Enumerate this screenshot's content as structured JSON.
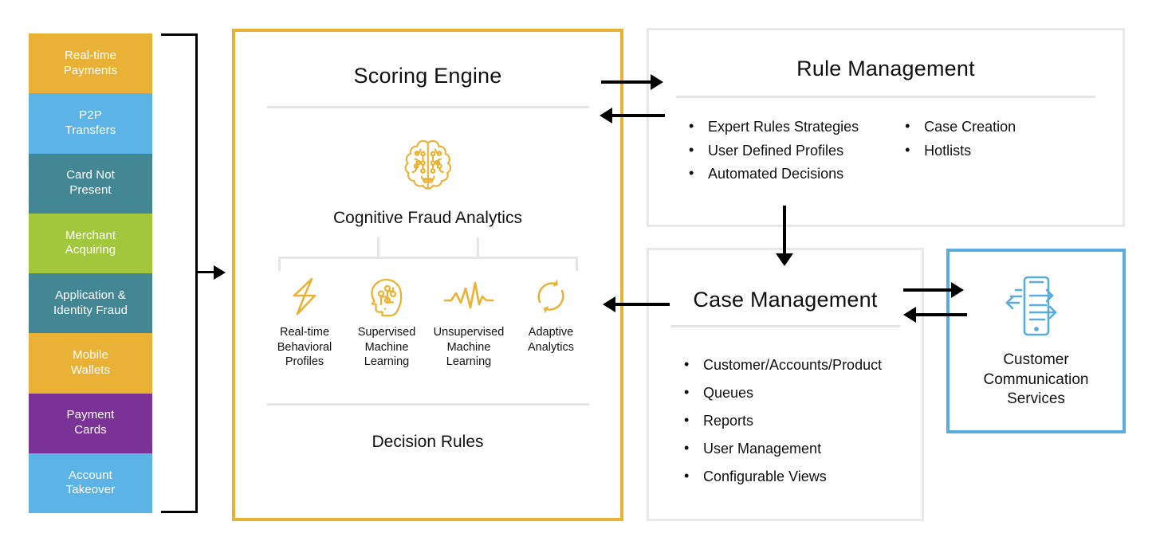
{
  "channels": {
    "items": [
      {
        "label_line1": "Real-time",
        "label_line2": "Payments",
        "color": "#EAB137"
      },
      {
        "label_line1": "P2P",
        "label_line2": "Transfers",
        "color": "#5BB4E5"
      },
      {
        "label_line1": "Card Not",
        "label_line2": "Present",
        "color": "#438795"
      },
      {
        "label_line1": "Merchant",
        "label_line2": "Acquiring",
        "color": "#A2C63C"
      },
      {
        "label_line1": "Application &",
        "label_line2": "Identity Fraud",
        "color": "#438795"
      },
      {
        "label_line1": "Mobile",
        "label_line2": "Wallets",
        "color": "#EAB137"
      },
      {
        "label_line1": "Payment",
        "label_line2": "Cards",
        "color": "#7B3296"
      },
      {
        "label_line1": "Account",
        "label_line2": "Takeover",
        "color": "#5BB4E5"
      }
    ]
  },
  "scoring_engine": {
    "title": "Scoring Engine",
    "brain_icon": "cognitive-brain-icon",
    "cognitive_label": "Cognitive Fraud Analytics",
    "features": [
      {
        "icon": "lightning-bolt-icon",
        "label": "Real-time\nBehavioral\nProfiles",
        "lines": [
          "Real-time",
          "Behavioral",
          "Profiles"
        ]
      },
      {
        "icon": "circuit-head-icon",
        "label": "Supervised\nMachine\nLearning",
        "lines": [
          "Supervised",
          "Machine",
          "Learning"
        ]
      },
      {
        "icon": "waveform-icon",
        "label": "Unsupervised\nMachine\nLearning",
        "lines": [
          "Unsupervised",
          "Machine",
          "Learning"
        ]
      },
      {
        "icon": "circular-arrows-icon",
        "label": "Adaptive\nAnalytics",
        "lines": [
          "Adaptive",
          "Analytics"
        ]
      }
    ],
    "decision_label": "Decision Rules",
    "border_color": "#E8B235"
  },
  "rule_management": {
    "title": "Rule Management",
    "bullets_left": [
      "Expert Rules Strategies",
      "User Defined Profiles",
      "Automated Decisions"
    ],
    "bullets_right": [
      "Case Creation",
      "Hotlists"
    ],
    "border_color": "#E8E8E8"
  },
  "case_management": {
    "title": "Case Management",
    "bullets": [
      "Customer/Accounts/Product",
      "Queues",
      "Reports",
      "User Management",
      "Configurable Views"
    ],
    "border_color": "#E8E8E8"
  },
  "customer_communication": {
    "icon": "mobile-message-exchange-icon",
    "label_lines": [
      "Customer",
      "Communication",
      "Services"
    ],
    "border_color": "#5AABDE",
    "icon_color": "#5AABDE"
  },
  "connectors": {
    "channels_to_scoring": "right-arrow",
    "scoring_to_rule": "right-arrow",
    "rule_to_scoring": "left-arrow",
    "rule_to_case": "down-arrow",
    "case_to_scoring": "left-arrow",
    "case_to_ccs": "right-arrow",
    "ccs_to_case": "left-arrow",
    "color": "#000000"
  }
}
